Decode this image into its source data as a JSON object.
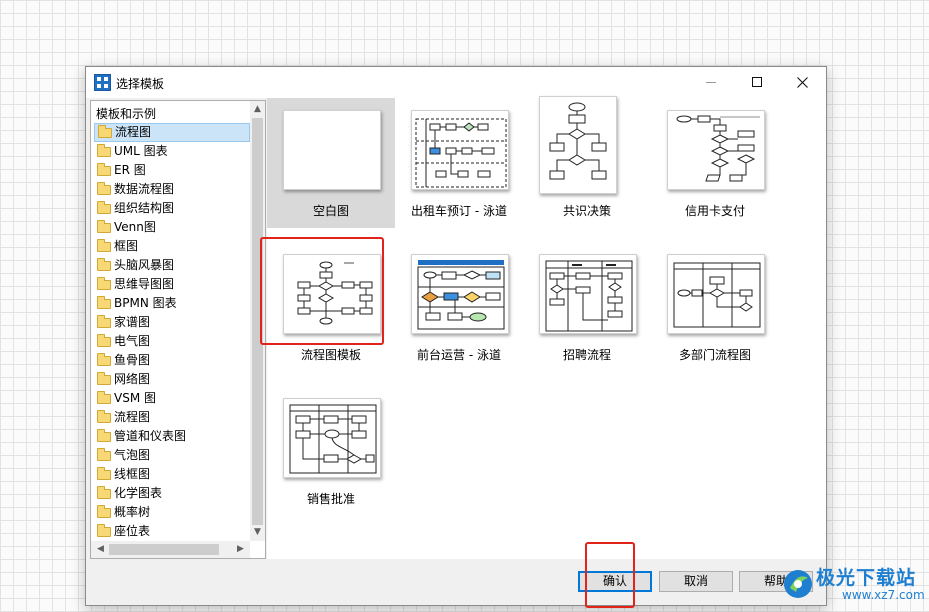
{
  "window": {
    "title": "选择模板",
    "icon": "template-app-icon"
  },
  "tree": {
    "header": "模板和示例",
    "items": [
      "流程图",
      "UML 图表",
      "ER 图",
      "数据流程图",
      "组织结构图",
      "Venn图",
      "框图",
      "头脑风暴图",
      "思维导图图",
      "BPMN 图表",
      "家谱图",
      "电气图",
      "鱼骨图",
      "网络图",
      "VSM 图",
      "流程图",
      "管道和仪表图",
      "气泡图",
      "线框图",
      "化学图表",
      "概率树",
      "座位表"
    ],
    "selected_index": 0
  },
  "templates": [
    {
      "label": "空白图",
      "selected": true
    },
    {
      "label": "出租车预订 - 泳道",
      "selected": false
    },
    {
      "label": "共识决策",
      "selected": false
    },
    {
      "label": "信用卡支付",
      "selected": false
    },
    {
      "label": "流程图模板",
      "selected": false
    },
    {
      "label": "前台运营 - 泳道",
      "selected": false
    },
    {
      "label": "招聘流程",
      "selected": false
    },
    {
      "label": "多部门流程图",
      "selected": false
    },
    {
      "label": "销售批准",
      "selected": false
    }
  ],
  "buttons": {
    "ok": "确认",
    "cancel": "取消",
    "help": "帮助"
  },
  "watermark": {
    "text": "极光下载站",
    "url": "www.xz7.com"
  },
  "colors": {
    "highlight_red": "#e2231a",
    "selection_blue": "#cce4f7",
    "primary_button_border": "#0078d7",
    "watermark_blue": "#1e7fd0"
  }
}
